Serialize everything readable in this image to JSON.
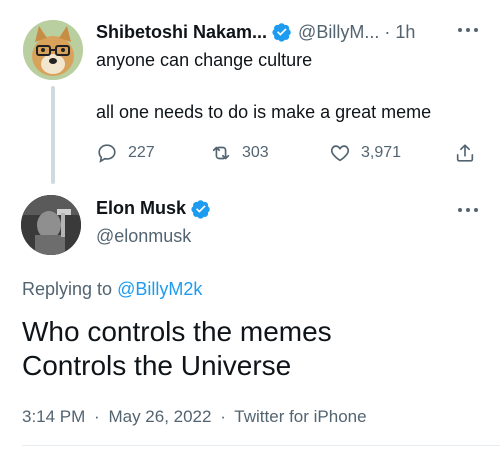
{
  "parent_tweet": {
    "author_name": "Shibetoshi Nakam...",
    "author_handle": "@BillyM...",
    "separator": "·",
    "time_ago": "1h",
    "text_line_1": "anyone can change culture",
    "text_line_2": "all one needs to do is make a great meme",
    "reply_count": "227",
    "retweet_count": "303",
    "like_count": "3,971",
    "icons": [
      "reply-icon",
      "retweet-icon",
      "like-icon",
      "share-icon",
      "more-icon",
      "verified-badge-icon"
    ]
  },
  "main_tweet": {
    "author_name": "Elon Musk",
    "author_handle": "@elonmusk",
    "replying_prefix": "Replying to",
    "replying_to": "@BillyM2k",
    "body_line_1": "Who controls the memes",
    "body_line_2": "Controls the Universe",
    "time": "3:14 PM",
    "date": "May 26, 2022",
    "source": "Twitter for iPhone",
    "separator": "·"
  },
  "colors": {
    "accent_blue": "#1d9bf0",
    "text_primary": "#0f1419",
    "text_secondary": "#536471",
    "thread_line": "#cfd9de"
  }
}
